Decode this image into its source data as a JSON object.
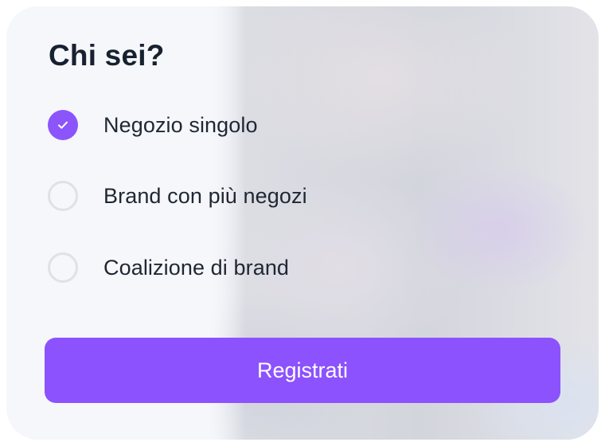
{
  "form": {
    "title": "Chi sei?",
    "options": [
      {
        "label": "Negozio singolo",
        "selected": true,
        "icon": "check-icon"
      },
      {
        "label": "Brand con più negozi",
        "selected": false
      },
      {
        "label": "Coalizione di brand",
        "selected": false
      }
    ],
    "submit_label": "Registrati"
  },
  "colors": {
    "accent": "#8c52fd",
    "title_text": "#172130",
    "option_text": "#1f2733",
    "radio_border": "#dfe1e6",
    "card_background": "#f5f7fb"
  }
}
